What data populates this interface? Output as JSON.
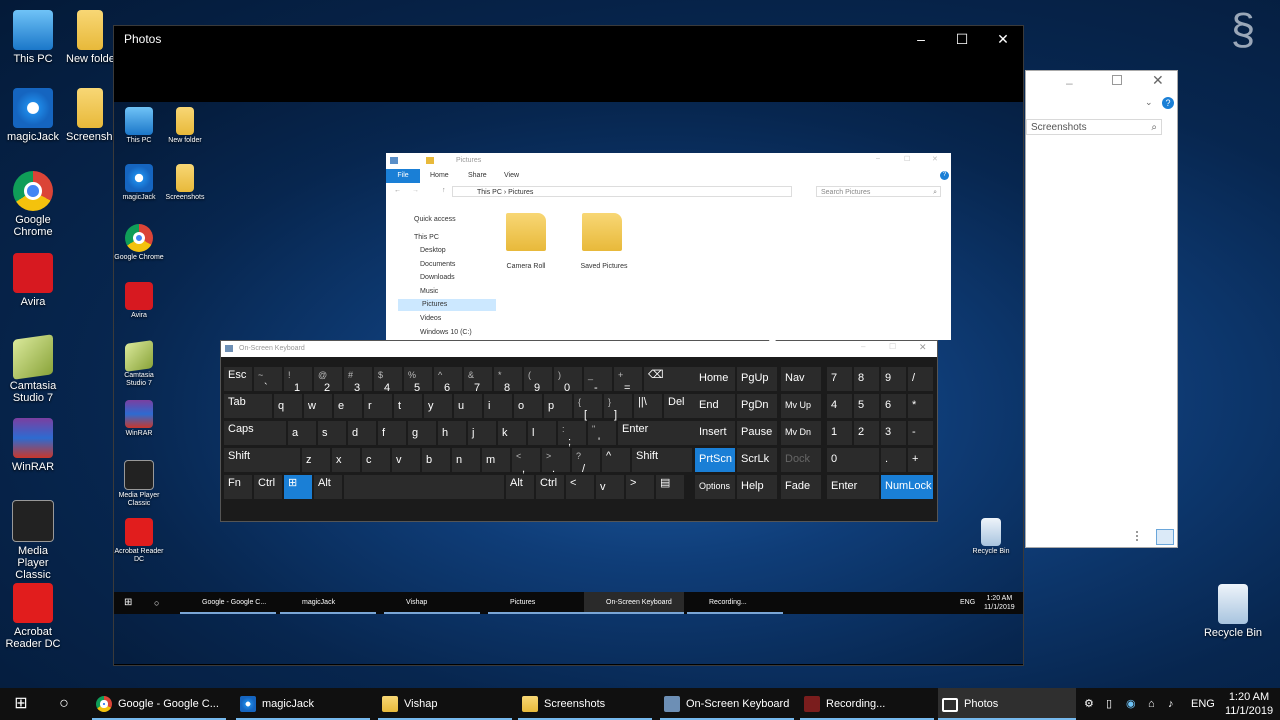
{
  "desktop_icons": [
    {
      "label": "This PC",
      "icon": "thispc"
    },
    {
      "label": "New folder",
      "icon": "folder"
    },
    {
      "label": "magicJack",
      "icon": "magic"
    },
    {
      "label": "Screenshots",
      "icon": "folder"
    },
    {
      "label": "Google Chrome",
      "icon": "chrome"
    },
    {
      "label": "Avira",
      "icon": "avira"
    },
    {
      "label": "Camtasia Studio 7",
      "icon": "camtasia"
    },
    {
      "label": "WinRAR",
      "icon": "winrar"
    },
    {
      "label": "Media Player Classic",
      "icon": "mpc"
    },
    {
      "label": "Acrobat Reader DC",
      "icon": "acrobat"
    },
    {
      "label": "Recycle Bin",
      "icon": "recycle"
    }
  ],
  "photos_window": {
    "title": "Photos"
  },
  "inner_desktop_icons": [
    "This PC",
    "New folder",
    "magicJack",
    "Screenshots",
    "Google Chrome",
    "Avira",
    "Camtasia Studio 7",
    "WinRAR",
    "Media Player Classic",
    "Acrobat Reader DC",
    "Recycle Bin"
  ],
  "explorer": {
    "title": "Pictures",
    "ribbon": [
      "File",
      "Home",
      "Share",
      "View"
    ],
    "path": [
      "This PC",
      "Pictures"
    ],
    "search_placeholder": "Search Pictures",
    "nav": [
      "Quick access",
      "This PC",
      "Desktop",
      "Documents",
      "Downloads",
      "Music",
      "Pictures",
      "Videos",
      "Windows 10 (C:)"
    ],
    "folders": [
      "Camera Roll",
      "Saved Pictures"
    ]
  },
  "osk": {
    "title": "On-Screen Keyboard",
    "rows": [
      [
        "Esc",
        "~|`",
        "!|1",
        "@|2",
        "#|3",
        "$|4",
        "%|5",
        "^|6",
        "&|7",
        "*|8",
        "(|9",
        ")|0",
        "_|-",
        "+|=",
        "⌫"
      ],
      [
        "Tab",
        "q",
        "w",
        "e",
        "r",
        "t",
        "y",
        "u",
        "i",
        "o",
        "p",
        "{|[",
        "}|]",
        "||\\",
        "Del"
      ],
      [
        "Caps",
        "a",
        "s",
        "d",
        "f",
        "g",
        "h",
        "j",
        "k",
        "l",
        ":|;",
        "\"|'",
        "Enter"
      ],
      [
        "Shift",
        "z",
        "x",
        "c",
        "v",
        "b",
        "n",
        "m",
        "<|,",
        ">|.",
        "?|/",
        "^",
        "Shift"
      ],
      [
        "Fn",
        "Ctrl",
        "⊞",
        "Alt",
        "",
        "Alt",
        "Ctrl",
        "<",
        "v",
        ">",
        "▤"
      ]
    ],
    "nav_keys": [
      "Home",
      "PgUp",
      "Nav",
      "End",
      "PgDn",
      "Mv Up",
      "Insert",
      "Pause",
      "Mv Dn",
      "PrtScn",
      "ScrLk",
      "Dock",
      "Options",
      "Help",
      "Fade"
    ],
    "numpad": [
      "7",
      "8",
      "9",
      "/",
      "4",
      "5",
      "6",
      "*",
      "1",
      "2",
      "3",
      "-",
      "0",
      ".",
      "+",
      "Enter",
      "NumLock"
    ]
  },
  "inner_taskbar": {
    "items": [
      "Google - Google C...",
      "magicJack",
      "Vishap",
      "Pictures",
      "On-Screen Keyboard",
      "Recording..."
    ],
    "lang": "ENG",
    "time": "1:20 AM",
    "date": "11/1/2019"
  },
  "right_window": {
    "search_text": "Screenshots"
  },
  "taskbar": {
    "items": [
      "Google - Google C...",
      "magicJack",
      "Vishap",
      "Screenshots",
      "On-Screen Keyboard",
      "Recording...",
      "Photos"
    ],
    "lang": "ENG",
    "time": "1:20 AM",
    "date": "11/1/2019"
  },
  "colors": {
    "accent": "#1a7fd6",
    "taskbar": "#101010",
    "folder": "#e8b93a"
  }
}
